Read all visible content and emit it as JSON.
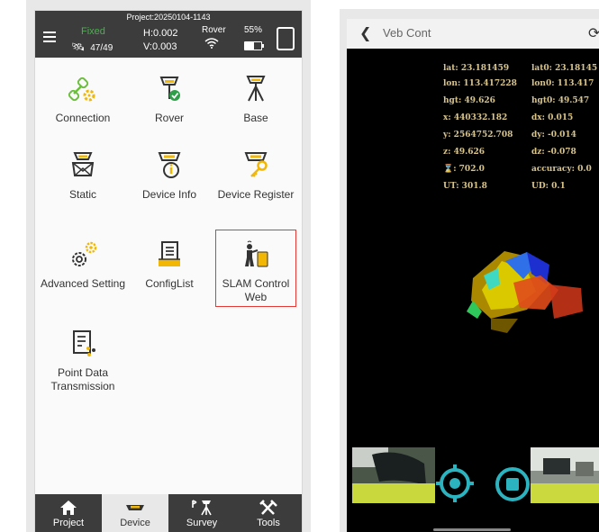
{
  "left_app": {
    "status": {
      "project": "Project:20250104-1143",
      "fix": "Fixed",
      "satellites": "47/49",
      "h": "H:0.002",
      "v": "V:0.003",
      "mode": "Rover",
      "battery": "55%"
    },
    "menu": [
      {
        "label": "Connection"
      },
      {
        "label": "Rover"
      },
      {
        "label": "Base"
      },
      {
        "label": "Static"
      },
      {
        "label": "Device Info"
      },
      {
        "label": "Device Register"
      },
      {
        "label": "Advanced Setting"
      },
      {
        "label": "ConfigList"
      },
      {
        "label": "SLAM Control Web"
      },
      {
        "label": "Point Data Transmission"
      }
    ],
    "bottom_nav": [
      {
        "label": "Project"
      },
      {
        "label": "Device"
      },
      {
        "label": "Survey"
      },
      {
        "label": "Tools"
      }
    ]
  },
  "right_app": {
    "header_title": "Veb Cont",
    "readouts_col1": [
      "lat: 23.181459",
      "lon: 113.417228",
      "hgt: 49.626",
      "x: 440332.182",
      "y: 2564752.708",
      "z: 49.626",
      ": 702.0",
      "UT: 301.8"
    ],
    "readouts_col2": [
      "lat0: 23.18145",
      "lon0: 113.417",
      "hgt0: 49.547",
      "dx: 0.015",
      "dy: -0.014",
      "dz: -0.078",
      "accuracy: 0.0",
      "UD: 0.1"
    ],
    "colors": {
      "accent_red": "#e53935",
      "control_cyan": "#2bb3c0",
      "fixed_green": "#4caf50"
    }
  }
}
